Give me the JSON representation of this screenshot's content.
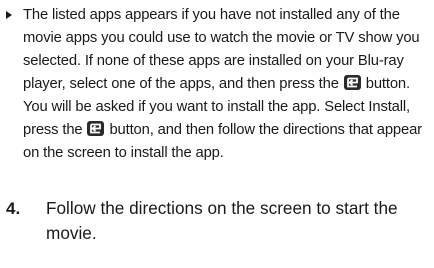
{
  "note": {
    "part1": "The listed apps appears if you have not installed any of the movie apps you could use to watch the movie or TV show you selected. If none of these apps are installed on your Blu-ray player, select one of the apps, and then press the",
    "part2": "button. You will be asked if you want to install the app. Select Install, press the",
    "part3": "button, and then follow the directions that appear on the screen to install the app.",
    "icon": "enter-button-icon"
  },
  "step": {
    "number": "4.",
    "text": "Follow the directions on the screen to start the movie."
  }
}
